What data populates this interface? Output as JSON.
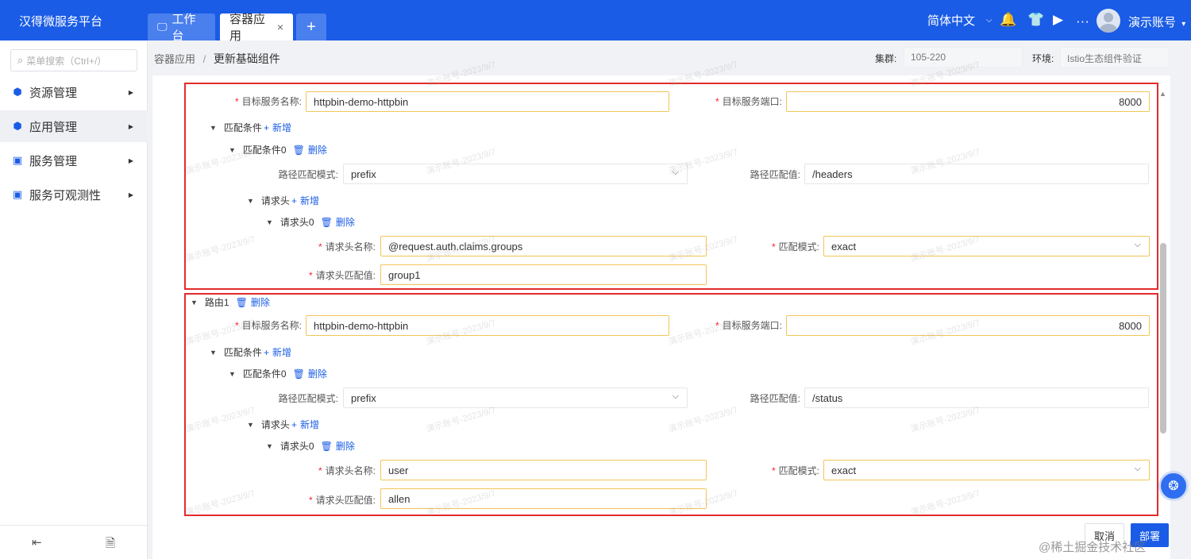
{
  "app": {
    "title": "汉得微服务平台"
  },
  "tabs": [
    {
      "label": "工作台",
      "icon": "monitor-icon"
    },
    {
      "label": "容器应用",
      "close": "×"
    },
    {
      "label": "+"
    }
  ],
  "header": {
    "language": "简体中文",
    "account": "演示账号",
    "more": "···"
  },
  "sidebar": {
    "search_placeholder": "菜单搜索（Ctrl+/）",
    "items": [
      {
        "label": "资源管理",
        "icon": "cube-icon"
      },
      {
        "label": "应用管理",
        "icon": "cube-icon",
        "active": true
      },
      {
        "label": "服务管理",
        "icon": "code-window-icon"
      },
      {
        "label": "服务可观测性",
        "icon": "code-window-icon"
      }
    ]
  },
  "breadcrumb": {
    "parent": "容器应用",
    "separator": "/",
    "current": "更新基础组件"
  },
  "meta": {
    "cluster_label": "集群:",
    "cluster_value": "105-220",
    "env_label": "环境:",
    "env_value": "Istio生态组件验证"
  },
  "form": {
    "target_service_label": "目标服务名称:",
    "target_port_label": "目标服务端口:",
    "match_conditions_label": "匹配条件",
    "add_label": "新增",
    "delete_label": "删除",
    "path_mode_label": "路径匹配模式:",
    "path_value_label": "路径匹配值:",
    "headers_label": "请求头",
    "header_name_label": "请求头名称:",
    "match_mode_label": "匹配模式:",
    "header_value_label": "请求头匹配值:"
  },
  "route0": {
    "target_service": "httpbin-demo-httpbin",
    "target_port": "8000",
    "condition_label": "匹配条件0",
    "path_mode": "prefix",
    "path_value": "/headers",
    "header_label": "请求头0",
    "header_name": "@request.auth.claims.groups",
    "match_mode": "exact",
    "header_value": "group1"
  },
  "route1": {
    "label": "路由1",
    "target_service": "httpbin-demo-httpbin",
    "target_port": "8000",
    "condition_label": "匹配条件0",
    "path_mode": "prefix",
    "path_value": "/status",
    "header_label": "请求头0",
    "header_name": "user",
    "match_mode": "exact",
    "header_value": "allen"
  },
  "footer": {
    "cancel": "取消",
    "deploy": "部署"
  },
  "watermark": "演示账号-2023/9/7",
  "site_mark": "@稀土掘金技术社区",
  "colors": {
    "primary": "#1a5ce6",
    "highlight_border": "#e32b2b",
    "required": "#f5222d",
    "input_focus_border": "#f2c55a"
  }
}
